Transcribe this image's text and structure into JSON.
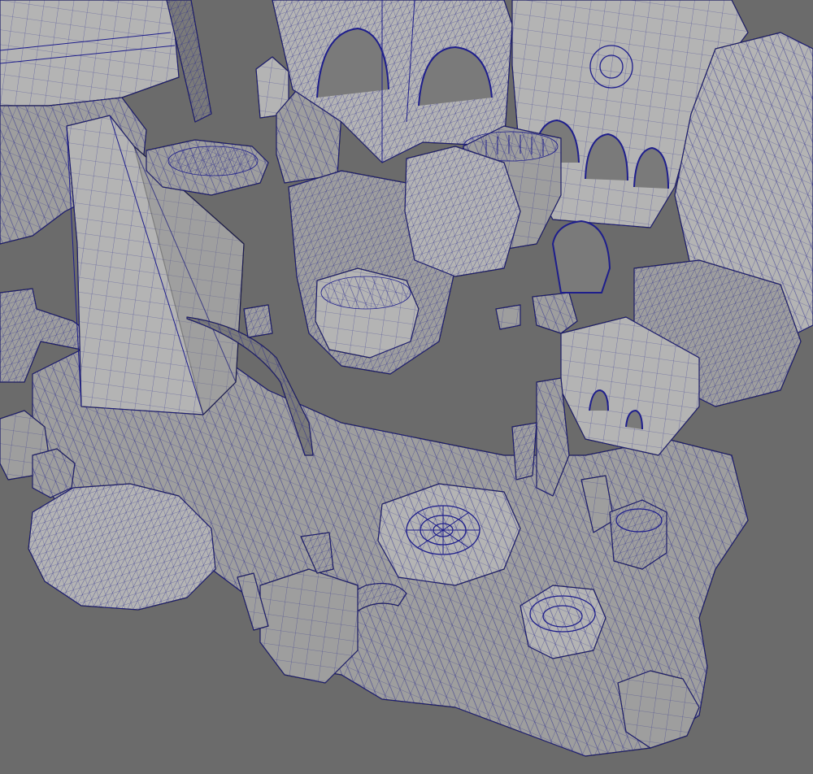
{
  "viewport": {
    "background_color": "#6b6b6b",
    "mesh_fill_color": "#9e9e9e",
    "mesh_fill_light_color": "#b4b4b4",
    "mesh_shadow_color": "#7a7a7a",
    "wireframe_color": "#1e1e8c",
    "outline_color": "#1a1a1a"
  }
}
